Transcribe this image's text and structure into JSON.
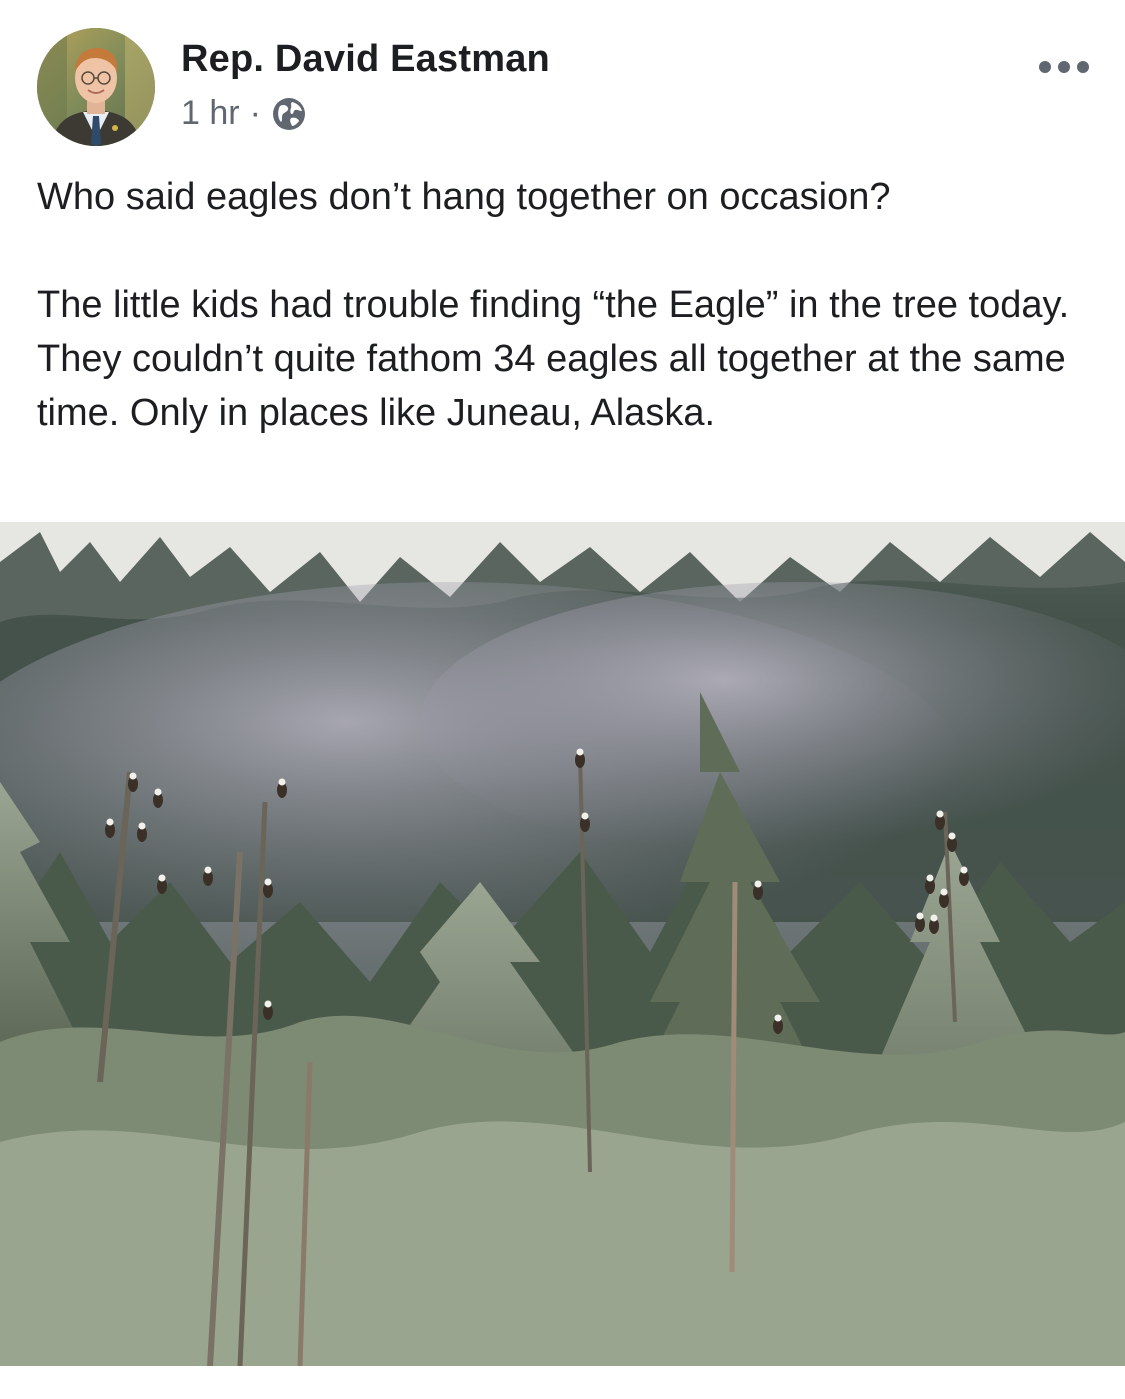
{
  "post": {
    "author": "Rep. David Eastman",
    "time": "1 hr",
    "separator": "·",
    "privacy_icon": "globe-icon",
    "more_icon": "more-options-icon",
    "paragraphs": [
      "Who said eagles don’t hang together on occasion?",
      "The little kids had trouble finding “the Eagle” in the tree today. They couldn’t quite fathom 34 eagles all together at the same time. Only in places like Juneau, Alaska."
    ]
  },
  "colors": {
    "text": "#1c1e21",
    "meta": "#606770",
    "background": "#ffffff"
  }
}
